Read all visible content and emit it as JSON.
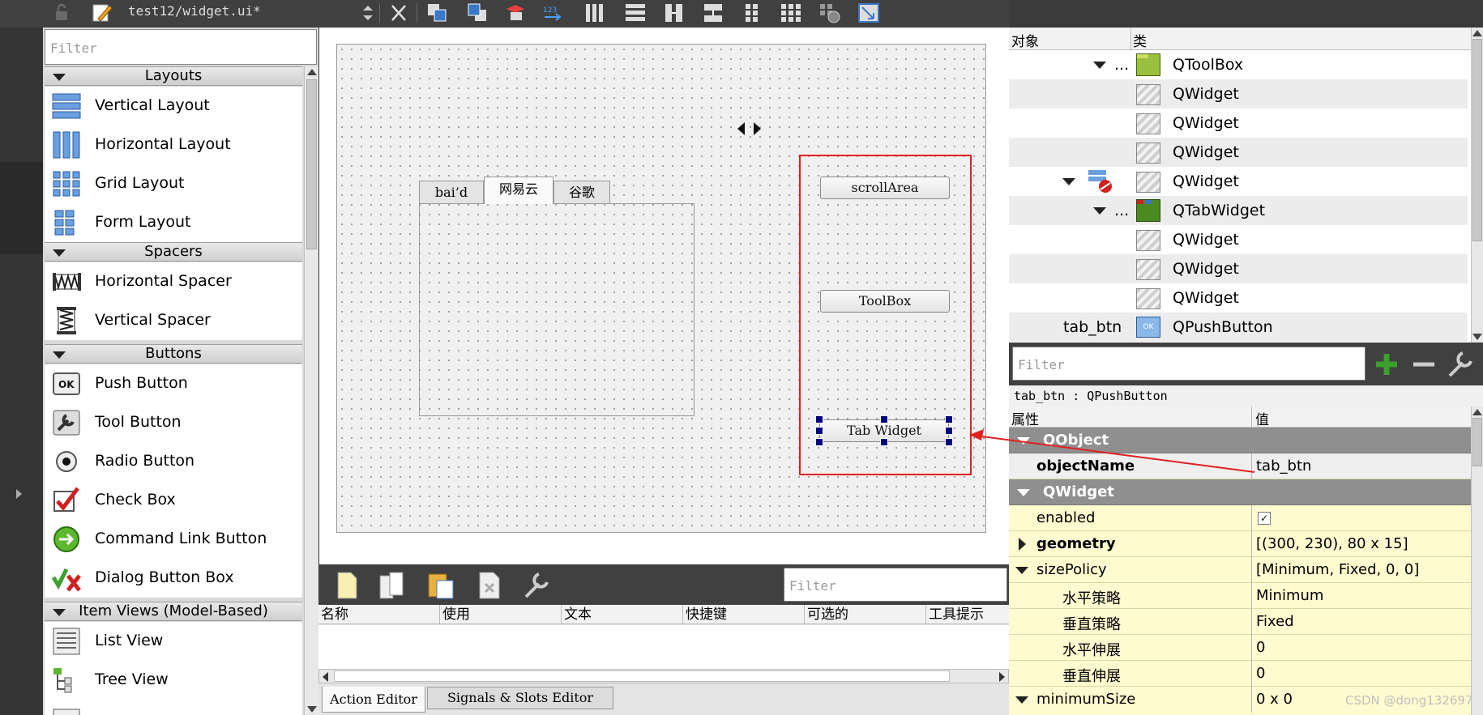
{
  "toolbar": {
    "file_name": "test12/widget.ui*",
    "icons": [
      "lock-icon",
      "edit-pencil-icon",
      "combo-arrows-icon",
      "close-icon",
      "send-to-back-icon",
      "bring-to-front-icon",
      "tab-order-icon",
      "buddy-icon",
      "hbox-icon",
      "vbox-icon",
      "splitter-h-icon",
      "splitter-v-icon",
      "grid-icon",
      "form-grid-icon",
      "break-layout-icon",
      "adjust-size-icon"
    ]
  },
  "widget_box": {
    "filter_placeholder": "Filter",
    "categories": {
      "layouts": "Layouts",
      "spacers": "Spacers",
      "buttons": "Buttons",
      "item_views": "Item Views (Model-Based)"
    },
    "items": {
      "vertical_layout": "Vertical Layout",
      "horizontal_layout": "Horizontal Layout",
      "grid_layout": "Grid Layout",
      "form_layout": "Form Layout",
      "horizontal_spacer": "Horizontal Spacer",
      "vertical_spacer": "Vertical Spacer",
      "push_button": "Push Button",
      "tool_button": "Tool Button",
      "radio_button": "Radio Button",
      "check_box": "Check Box",
      "command_link_button": "Command Link Button",
      "dialog_button_box": "Dialog Button Box",
      "list_view": "List View",
      "tree_view": "Tree View"
    }
  },
  "form": {
    "tabs": [
      "bai’d",
      "网易云",
      "谷歌"
    ],
    "buttons": {
      "scroll_area": "scrollArea",
      "tool_box": "ToolBox",
      "tab_widget": "Tab Widget"
    },
    "highlight_color": "#e02020"
  },
  "action_editor": {
    "filter_placeholder": "Filter",
    "columns": [
      "名称",
      "使用",
      "文本",
      "快捷键",
      "可选的",
      "工具提示"
    ],
    "tabs": {
      "action_editor": "Action Editor",
      "signals_slots": "Signals & Slots Editor"
    }
  },
  "object_inspector": {
    "header": {
      "object": "对象",
      "class": "类"
    },
    "rows": [
      {
        "object": "...",
        "cls": "QToolBox"
      },
      {
        "object": "",
        "cls": "QWidget"
      },
      {
        "object": "",
        "cls": "QWidget"
      },
      {
        "object": "",
        "cls": "QWidget"
      },
      {
        "object": "",
        "cls": "QWidget"
      },
      {
        "object": "...",
        "cls": "QTabWidget"
      },
      {
        "object": "",
        "cls": "QWidget"
      },
      {
        "object": "",
        "cls": "QWidget"
      },
      {
        "object": "",
        "cls": "QWidget"
      },
      {
        "object": "tab_btn",
        "cls": "QPushButton"
      }
    ]
  },
  "property_editor": {
    "filter_placeholder": "Filter",
    "title": "tab_btn : QPushButton",
    "header": {
      "property": "属性",
      "value": "值"
    },
    "rows": {
      "qobject": "QObject",
      "object_name": "objectName",
      "object_name_val": "tab_btn",
      "qwidget": "QWidget",
      "enabled": "enabled",
      "geometry": "geometry",
      "geometry_val": "[(300, 230), 80 x 15]",
      "size_policy": "sizePolicy",
      "size_policy_val": "[Minimum, Fixed, 0, 0]",
      "h_policy": "水平策略",
      "h_policy_val": "Minimum",
      "v_policy": "垂直策略",
      "v_policy_val": "Fixed",
      "h_stretch": "水平伸展",
      "h_stretch_val": "0",
      "v_stretch": "垂直伸展",
      "v_stretch_val": "0",
      "minimum_size": "minimumSize",
      "minimum_size_val": "0 x 0"
    }
  },
  "watermark": "CSDN @dong132697"
}
